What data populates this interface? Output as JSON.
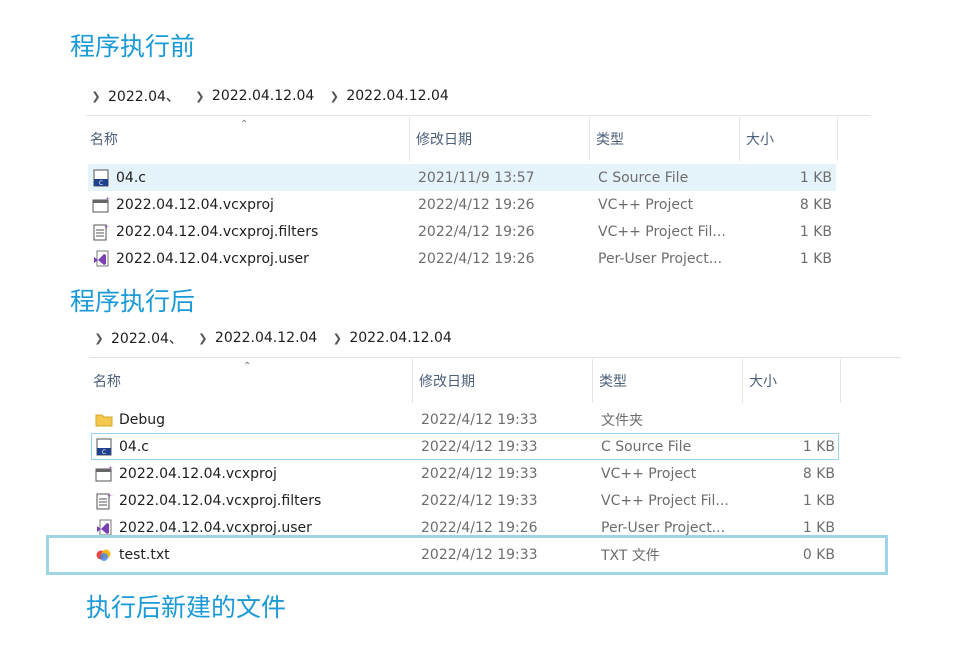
{
  "before": {
    "heading": "程序执行前",
    "breadcrumb": [
      "2022.04、",
      "2022.04.12.04",
      "2022.04.12.04"
    ],
    "columns": [
      "名称",
      "修改日期",
      "类型",
      "大小"
    ],
    "files": [
      {
        "name": "04.c",
        "date": "2021/11/9 13:57",
        "type": "C Source File",
        "size": "1 KB",
        "icon": "c-source-file-icon"
      },
      {
        "name": "2022.04.12.04.vcxproj",
        "date": "2022/4/12 19:26",
        "type": "VC++ Project",
        "size": "8 KB",
        "icon": "vcxproj-file-icon"
      },
      {
        "name": "2022.04.12.04.vcxproj.filters",
        "date": "2022/4/12 19:26",
        "type": "VC++ Project Fil...",
        "size": "1 KB",
        "icon": "filters-file-icon"
      },
      {
        "name": "2022.04.12.04.vcxproj.user",
        "date": "2022/4/12 19:26",
        "type": "Per-User Project...",
        "size": "1 KB",
        "icon": "visual-studio-user-file-icon"
      }
    ]
  },
  "after": {
    "heading": "程序执行后",
    "breadcrumb": [
      "2022.04、",
      "2022.04.12.04",
      "2022.04.12.04"
    ],
    "columns": [
      "名称",
      "修改日期",
      "类型",
      "大小"
    ],
    "files": [
      {
        "name": "Debug",
        "date": "2022/4/12 19:33",
        "type": "文件夹",
        "size": "",
        "icon": "folder-icon"
      },
      {
        "name": "04.c",
        "date": "2022/4/12 19:33",
        "type": "C Source File",
        "size": "1 KB",
        "icon": "c-source-file-icon"
      },
      {
        "name": "2022.04.12.04.vcxproj",
        "date": "2022/4/12 19:33",
        "type": "VC++ Project",
        "size": "8 KB",
        "icon": "vcxproj-file-icon"
      },
      {
        "name": "2022.04.12.04.vcxproj.filters",
        "date": "2022/4/12 19:33",
        "type": "VC++ Project Fil...",
        "size": "1 KB",
        "icon": "filters-file-icon"
      },
      {
        "name": "2022.04.12.04.vcxproj.user",
        "date": "2022/4/12 19:26",
        "type": "Per-User Project...",
        "size": "1 KB",
        "icon": "visual-studio-user-file-icon"
      },
      {
        "name": "test.txt",
        "date": "2022/4/12 19:33",
        "type": "TXT 文件",
        "size": "0 KB",
        "icon": "txt-file-icon"
      }
    ]
  },
  "annotation": "执行后新建的文件",
  "colors": {
    "heading": "#1a9ad6",
    "highlight_border": "#9fd6e6",
    "selection": "#e5f3fb"
  }
}
